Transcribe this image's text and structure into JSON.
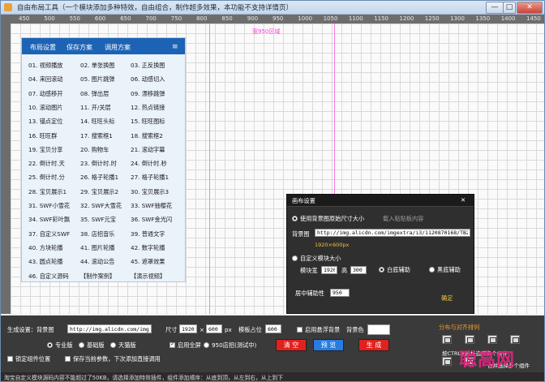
{
  "window": {
    "title": "自由布局工具（一个模块添加多种特效，自由组合，制作超多效果，本功能不支持详情页）",
    "minimize": "—",
    "maximize": "□",
    "close": "✕"
  },
  "ruler": {
    "ticks": [
      "450",
      "500",
      "550",
      "600",
      "650",
      "700",
      "750",
      "800",
      "850",
      "900",
      "950",
      "1000",
      "1050",
      "1100",
      "1150",
      "1200",
      "1250",
      "1300",
      "1350",
      "1400",
      "1450"
    ]
  },
  "canvas": {
    "guide_label": "宽950区域"
  },
  "panel": {
    "tabs": [
      "布局设置",
      "保存方案",
      "调用方案"
    ],
    "menu_icon": "≡",
    "rows": [
      [
        "01. 视频播放",
        "02. 单张换图",
        "03. 正反换图"
      ],
      [
        "04. 来回滚动",
        "05. 图片跳弹",
        "06. 动感切入"
      ],
      [
        "07. 动感移开",
        "08. 弹出层",
        "09. 漂移跳弹"
      ],
      [
        "10. 滚动图片",
        "11. 开/关层",
        "12. 热点链接"
      ],
      [
        "13. 锚点定位",
        "14. 旺旺头标",
        "15. 旺旺图标"
      ],
      [
        "16. 旺旺群",
        "17. 搜索框1",
        "18. 搜索框2"
      ],
      [
        "19. 宝贝分享",
        "20. 购物车",
        "21. 滚动字幕"
      ],
      [
        "22. 倒计时.天",
        "23. 倒计时.时",
        "24. 倒计时.秒"
      ],
      [
        "25. 倒计时.分",
        "26. 格子轮播1",
        "27. 格子轮播1"
      ],
      [
        "28. 宝贝展示1",
        "29. 宝贝展示2",
        "30. 宝贝展示3"
      ],
      [
        "31. SWF小雪花",
        "32. SWF大雪花",
        "33. SWF抽樱花"
      ],
      [
        "34. SWF彩叶飘",
        "35. SWF元宝",
        "36. SWF金光闪"
      ],
      [
        "37. 自定义SWF",
        "38. 店招音乐",
        "39. 普通文字"
      ],
      [
        "40. 方块轮播",
        "41. 图片轮播",
        "42. 数字轮播"
      ],
      [
        "43. 圆点轮播",
        "44. 滚动公告",
        "45. 遮罩效果"
      ],
      [
        "46. 自定义源码",
        "【制作案例】",
        "【演示视频】"
      ]
    ]
  },
  "dialog": {
    "title": "画布设置",
    "close": "✕",
    "use_bg_label": "使用背景图原始尺寸大小",
    "load_btn": "载入粘贴板内容",
    "bg_label": "背景图",
    "bg_value": "http://img.alicdn.com/imgextra/i3/1120870168/TB2T",
    "size_hint": "1920×600px",
    "custom_label": "自定义模块大小",
    "width_label": "模块宽",
    "width_value": "1920",
    "height_label": "高",
    "height_value": "300",
    "auto_assist": "白底辅助",
    "dark_assist": "黑底辅助",
    "center_label": "居中辅助性",
    "center_value": "950",
    "confirm": "确定"
  },
  "bottom": {
    "gen_label": "生成设置：背景图",
    "bg_value": "http://img.alicdn.com/imgext",
    "size_label": "尺寸",
    "w_value": "1920",
    "x": "×",
    "h_value": "600",
    "unit": "px",
    "template_label": "模板占位",
    "template_value": "600",
    "float_bg": "启用悬浮背景",
    "bg_color": "背景色",
    "mode_pro": "专业版",
    "mode_basic": "基础版",
    "mode_tmall": "天猫版",
    "fullscreen": "启用全屏",
    "shop950": "950店招(测试中)",
    "lock": "锁定组件位置",
    "save_auto": "保存当前参数，下次添加直接调用",
    "btn_clear": "清  空",
    "btn_gen": "预  览",
    "btn_make": "生  成",
    "align_title": "分布与对齐排列",
    "align_hint": "按CTRL+鼠标选择多个组件",
    "merge": "合并选择多个组件"
  },
  "status": {
    "text": "淘宝自定义模块源码内容不能超过了50KB，请选择添加特效插件，组件添加顺序：从底到顶，从左到右，从上到下"
  },
  "watermark": "聪高网",
  "colors": {
    "panel_head": "#1d63b5",
    "dialog_bg": "#2f2f2f",
    "btn_red": "#e0221f",
    "btn_blue": "#2a7be0",
    "guide": "#ff3fd3"
  }
}
